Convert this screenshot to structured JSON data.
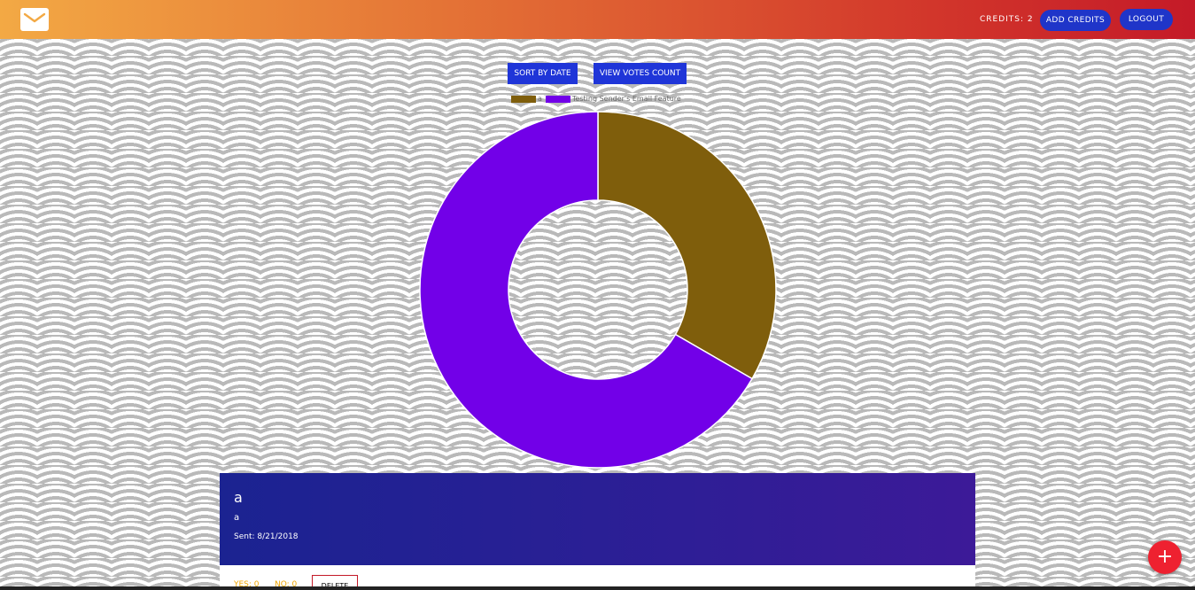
{
  "navbar": {
    "logo_icon": "mail-icon",
    "credits_label": "CREDITS: 2",
    "add_credits_label": "ADD CREDITS",
    "logout_label": "LOGOUT",
    "gradient_colors": [
      "#f3a944",
      "#e36f35",
      "#d2362b",
      "#c41a28"
    ]
  },
  "toolbar": {
    "sort_label": "SORT BY DATE",
    "votes_label": "VIEW VOTES COUNT"
  },
  "chart_data": {
    "type": "doughnut",
    "series": [
      {
        "name": "a",
        "value": 1,
        "color": "#7f5e0c"
      },
      {
        "name": "Testing Sender's Email Feature",
        "value": 2,
        "color": "#7200e8"
      }
    ],
    "legend_position": "top"
  },
  "survey": {
    "title": "a",
    "body": "a",
    "sent": "Sent: 8/21/2018",
    "yes_label": "YES: 0",
    "no_label": "NO: 0",
    "delete_label": "DELETE"
  },
  "fab": {
    "label": "+",
    "icon": "add-icon"
  }
}
